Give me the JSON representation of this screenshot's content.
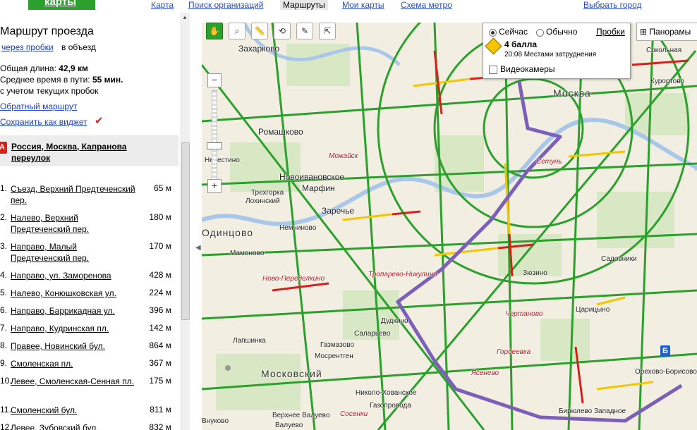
{
  "header": {
    "logo": "карты",
    "nav": [
      {
        "label": "Карта",
        "active": false
      },
      {
        "label": "Поиск организаций",
        "active": false
      },
      {
        "label": "Маршруты",
        "active": true
      },
      {
        "label": "Мои карты",
        "active": false
      },
      {
        "label": "Схема метро",
        "active": false
      }
    ],
    "city_link": "Выбрать город"
  },
  "route": {
    "title": "Маршрут проезда",
    "option_via_traffic": "через пробки",
    "option_bypass": "в объезд",
    "total_length_label": "Общая длина:",
    "total_length": "42,9 км",
    "avg_time_label": "Среднее время в пути:",
    "avg_time": "55 мин.",
    "traffic_note": "с учетом текущих пробок",
    "reverse_link": "Обратный маршрут",
    "widget_link": "Сохранить как виджет",
    "start_marker": "А",
    "start_address": "Россия, Москва, Капранова переулок",
    "steps": [
      {
        "num": "1.",
        "text": "Съезд, Верхний Предтеченский пер.",
        "dist": "65 м"
      },
      {
        "num": "2.",
        "text": "Налево, Верхний Предтеченский пер.",
        "dist": "180 м"
      },
      {
        "num": "3.",
        "text": "Направо, Малый Предтеченский пер.",
        "dist": "170 м"
      },
      {
        "num": "4.",
        "text": "Направо, ул. Заморенова",
        "dist": "428 м"
      },
      {
        "num": "5.",
        "text": "Налево, Конюшковская ул.",
        "dist": "224 м"
      },
      {
        "num": "6.",
        "text": "Направо, Баррикадная ул.",
        "dist": "396 м"
      },
      {
        "num": "7.",
        "text": "Направо, Кудринская пл.",
        "dist": "142 м"
      },
      {
        "num": "8.",
        "text": "Правее, Новинский бул.",
        "dist": "864 м"
      },
      {
        "num": "9.",
        "text": "Смоленская пл.",
        "dist": "367 м"
      },
      {
        "num": "10.",
        "text": "Левее, Смоленская-Сенная пл.",
        "dist": "175 м"
      },
      {
        "num": "11.",
        "text": "Смоленский бул.",
        "dist": "811 м"
      },
      {
        "num": "12.",
        "text": "Левее, Зубовский бул.",
        "dist": "832 м"
      }
    ]
  },
  "map": {
    "toolbar_icons": [
      "hand-icon",
      "zoom-area-icon",
      "ruler-icon",
      "route-icon",
      "balloon-icon",
      "select-icon"
    ],
    "zoom_in": "+",
    "zoom_out": "−",
    "traffic_panel": {
      "now": "Сейчас",
      "usual": "Обычно",
      "title": "Пробки",
      "level": "4 балла",
      "status": "20:08 Местами затруднения",
      "cameras": "Видеокамеры"
    },
    "panoramas": "Панорамы",
    "end_marker": "Б",
    "labels": [
      "Захарково",
      "Москва",
      "Ромашково",
      "Новоивановское",
      "Марфин",
      "Трехгорка",
      "Лохинский",
      "Заречье",
      "Одинцово",
      "Немчиново",
      "Мамоново",
      "Ново-Переделкино",
      "Тропарево-Никулино",
      "Зюзино",
      "Чертаново",
      "Царицыно",
      "Садовники",
      "Лапшинка",
      "Саларьево",
      "Мосрентген",
      "Газмазово",
      "Московский",
      "Николо-Хованское",
      "Ясенево",
      "Орехово-Борисово",
      "Бирюлево",
      "Западное",
      "Внуково",
      "Газопровода",
      "Сосенки",
      "Валуево",
      "Верхнее Валуево",
      "Сокольная",
      "Курортово",
      "Гордеевка",
      "Дудкино",
      "Можайск",
      "Невестино",
      "Сетунь"
    ],
    "colors": {
      "free": "#2ca02c",
      "slow": "#f5c500",
      "jam": "#d7201b",
      "route": "#7b5fb8"
    }
  }
}
